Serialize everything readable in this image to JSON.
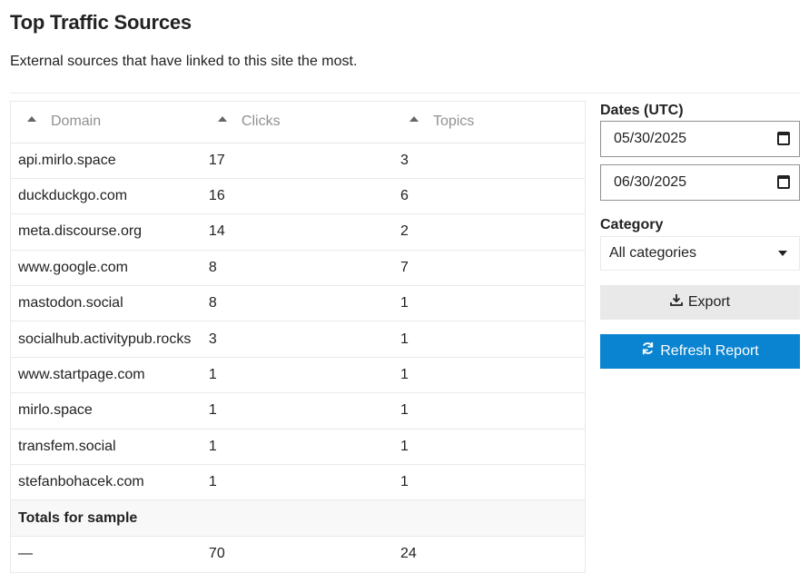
{
  "header": {
    "title": "Top Traffic Sources",
    "description": "External sources that have linked to this site the most."
  },
  "table": {
    "columns": [
      "Domain",
      "Clicks",
      "Topics"
    ],
    "rows": [
      {
        "domain": "api.mirlo.space",
        "clicks": "17",
        "topics": "3"
      },
      {
        "domain": "duckduckgo.com",
        "clicks": "16",
        "topics": "6"
      },
      {
        "domain": "meta.discourse.org",
        "clicks": "14",
        "topics": "2"
      },
      {
        "domain": "www.google.com",
        "clicks": "8",
        "topics": "7"
      },
      {
        "domain": "mastodon.social",
        "clicks": "8",
        "topics": "1"
      },
      {
        "domain": "socialhub.activitypub.rocks",
        "clicks": "3",
        "topics": "1"
      },
      {
        "domain": "www.startpage.com",
        "clicks": "1",
        "topics": "1"
      },
      {
        "domain": "mirlo.space",
        "clicks": "1",
        "topics": "1"
      },
      {
        "domain": "transfem.social",
        "clicks": "1",
        "topics": "1"
      },
      {
        "domain": "stefanbohacek.com",
        "clicks": "1",
        "topics": "1"
      }
    ],
    "totals_label": "Totals for sample",
    "totals": {
      "domain": "—",
      "clicks": "70",
      "topics": "24"
    }
  },
  "filters": {
    "dates_label": "Dates (UTC)",
    "start_date": "05/30/2025",
    "end_date": "06/30/2025",
    "category_label": "Category",
    "category_value": "All categories"
  },
  "actions": {
    "export_label": "Export",
    "refresh_label": "Refresh Report"
  },
  "colors": {
    "primary": "#0a84d0",
    "muted_text": "#919191",
    "border": "#e9e9e9"
  }
}
